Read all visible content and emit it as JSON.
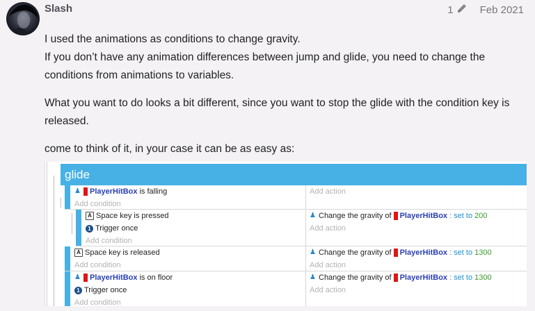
{
  "post": {
    "username": "Slash",
    "edit_count": "1",
    "date": "Feb 2021",
    "paragraphs": [
      "I used the animations as conditions to change gravity.",
      "If you don’t have any animation differences between jump and glide, you need to change the conditions from animations to variables.",
      "What you want to do looks a bit different, since you want to stop the glide with the condition key is released.",
      "come to think of it, in your case it can be as easy as:"
    ]
  },
  "sheet": {
    "group_title": "glide",
    "add_condition": "Add condition",
    "add_action": "Add action",
    "events": [
      {
        "conditions": [
          {
            "icon": "object",
            "object": "PlayerHitBox",
            "text": "is falling"
          }
        ],
        "actions": []
      },
      {
        "conditions": [
          {
            "icon": "key",
            "text": "Space key is pressed"
          },
          {
            "icon": "trigger",
            "text": "Trigger once"
          }
        ],
        "actions": [
          {
            "prefix": "Change the gravity of",
            "object": "PlayerHitBox",
            "setto": ": set to",
            "value": "200"
          }
        ]
      },
      {
        "conditions": [
          {
            "icon": "key",
            "text": "Space key is released"
          }
        ],
        "actions": [
          {
            "prefix": "Change the gravity of",
            "object": "PlayerHitBox",
            "setto": ": set to",
            "value": "1300"
          }
        ]
      },
      {
        "conditions": [
          {
            "icon": "object",
            "object": "PlayerHitBox",
            "text": "is on floor"
          },
          {
            "icon": "trigger",
            "text": "Trigger once"
          }
        ],
        "actions": [
          {
            "prefix": "Change the gravity of",
            "object": "PlayerHitBox",
            "setto": ": set to",
            "value": "1300"
          }
        ]
      }
    ]
  },
  "colors": {
    "accent": "#47b1e5",
    "object_name": "#2a3fb0",
    "number": "#3a9a2a",
    "object_icon": "#e01515"
  }
}
